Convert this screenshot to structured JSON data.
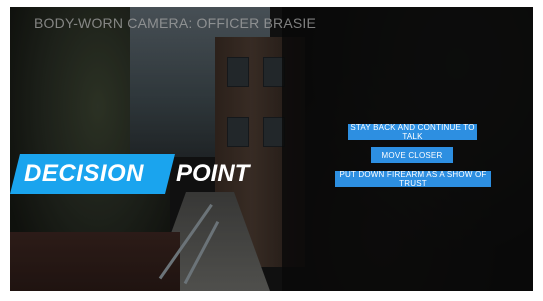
{
  "video": {
    "title": "BODY-WORN CAMERA: OFFICER BRASIE",
    "overlay_caption": "",
    "accent_color": "#1aa4ee",
    "button_color": "#2d8fe1"
  },
  "decision": {
    "word1": "DECISION",
    "word2": "POINT"
  },
  "choices": [
    {
      "label": "STAY BACK AND CONTINUE TO TALK"
    },
    {
      "label": "MOVE CLOSER"
    },
    {
      "label": "PUT DOWN FIREARM AS A SHOW OF TRUST"
    }
  ]
}
